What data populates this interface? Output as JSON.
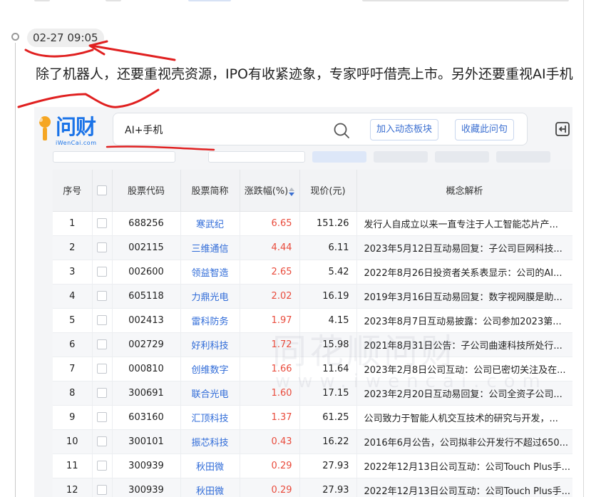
{
  "post": {
    "timestamp": "02-27 09:05",
    "text": "除了机器人，还要重视壳资源，IPO有收紧迹象，专家呼吁借壳上市。另外还要重视AI手机"
  },
  "app": {
    "logo_text": "问财",
    "logo_sub": "iWenCai.com",
    "search_value": "AI+手机",
    "add_board_label": "加入动态板块",
    "save_question_label": "收藏此问句",
    "watermark": "同花顺问财",
    "watermark_url": "www.iwencai.com"
  },
  "colors": {
    "accent": "#1a73e8",
    "rise": "#e94b3c",
    "link": "#2f6bd8",
    "annotation": "#e02020"
  },
  "table": {
    "headers": {
      "index": "序号",
      "code": "股票代码",
      "name": "股票简称",
      "change": "涨跌幅(%)",
      "price": "现价(元)",
      "concept": "概念解析"
    },
    "rows": [
      {
        "index": "1",
        "code": "688256",
        "name": "寒武纪",
        "change": "6.65",
        "price": "151.26",
        "concept": "发行人自成立以来一直专注于人工智能芯片产..."
      },
      {
        "index": "2",
        "code": "002115",
        "name": "三维通信",
        "change": "4.44",
        "price": "6.11",
        "concept": "2023年5月12日互动易回复：子公司巨网科技..."
      },
      {
        "index": "3",
        "code": "002600",
        "name": "领益智造",
        "change": "2.65",
        "price": "5.42",
        "concept": "2022年8月26日投资者关系表显示：公司的AI..."
      },
      {
        "index": "4",
        "code": "605118",
        "name": "力鼎光电",
        "change": "2.02",
        "price": "16.19",
        "concept": "2019年3月16日互动易回复：数字视网膜是助..."
      },
      {
        "index": "5",
        "code": "002413",
        "name": "雷科防务",
        "change": "1.97",
        "price": "4.15",
        "concept": "2023年8月7日互动易披露：公司参加2023第..."
      },
      {
        "index": "6",
        "code": "002729",
        "name": "好利科技",
        "change": "1.72",
        "price": "15.98",
        "concept": "2021年8月31日公告：子公司曲速科技所处行..."
      },
      {
        "index": "7",
        "code": "000810",
        "name": "创维数字",
        "change": "1.66",
        "price": "11.64",
        "concept": "2023年2月8日公司互动：公司已密切关注及在..."
      },
      {
        "index": "8",
        "code": "300691",
        "name": "联合光电",
        "change": "1.60",
        "price": "17.15",
        "concept": "2023年2月20日互动易回复：公司全资子公司..."
      },
      {
        "index": "9",
        "code": "603160",
        "name": "汇顶科技",
        "change": "1.37",
        "price": "61.25",
        "concept": "公司致力于智能人机交互技术的研究与开发，..."
      },
      {
        "index": "10",
        "code": "300101",
        "name": "振芯科技",
        "change": "0.43",
        "price": "16.22",
        "concept": "2016年6月公告，公司拟非公开发行不超过650..."
      },
      {
        "index": "11",
        "code": "300939",
        "name": "秋田微",
        "change": "0.29",
        "price": "27.93",
        "concept": "2022年12月13日公司互动：公司Touch Plus手..."
      },
      {
        "index": "12",
        "code": "300939",
        "name": "秋田微",
        "change": "0.29",
        "price": "27.93",
        "concept": "2022年12月13日公司互动：公司Touch Plus手..."
      }
    ]
  }
}
